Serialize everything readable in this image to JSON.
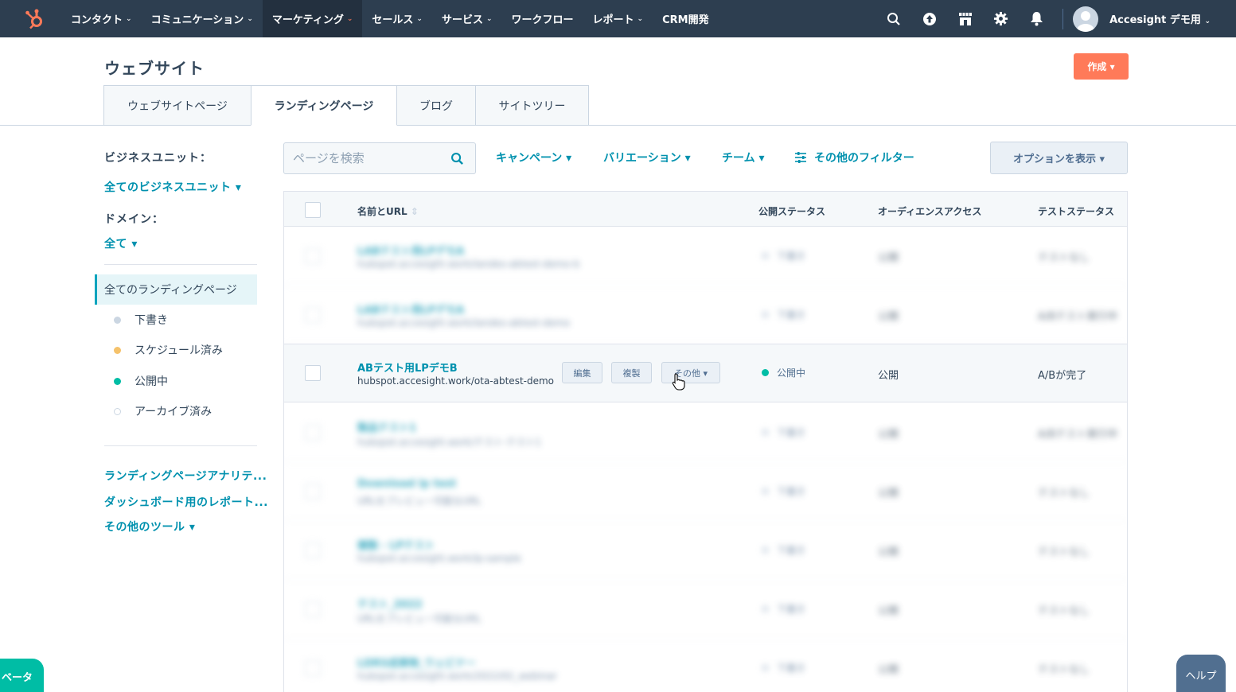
{
  "topnav": {
    "items": [
      {
        "label": "コンタクト",
        "has_menu": true
      },
      {
        "label": "コミュニケーション",
        "has_menu": true
      },
      {
        "label": "マーケティング",
        "has_menu": true,
        "active": true
      },
      {
        "label": "セールス",
        "has_menu": true
      },
      {
        "label": "サービス",
        "has_menu": true
      },
      {
        "label": "ワークフロー",
        "has_menu": false
      },
      {
        "label": "レポート",
        "has_menu": true
      },
      {
        "label": "CRM開発",
        "has_menu": false
      }
    ],
    "account_name": "Accesight デモ用",
    "brand_color": "#2d3e50",
    "chevron": "⌄",
    "icons": [
      "search-icon",
      "upgrade-icon",
      "marketplace-icon",
      "settings-icon",
      "notifications-icon"
    ]
  },
  "header": {
    "title": "ウェブサイト",
    "create_label": "作成 ▾",
    "accent": "#ff7a59"
  },
  "tabs": [
    "ウェブサイトページ",
    "ランディングページ",
    "ブログ",
    "サイトツリー"
  ],
  "sidebar": {
    "business_unit_label": "ビジネスユニット：",
    "business_unit_value": "全てのビジネスユニット ▾",
    "domain_label": "ドメイン：",
    "domain_value": "全て ▾",
    "all_pages": "全てのランディングページ",
    "statuses": [
      {
        "label": "下書き",
        "color": "#cbd6e2"
      },
      {
        "label": "スケジュール済み",
        "color": "#f5c26b"
      },
      {
        "label": "公開中",
        "color": "#00bda5"
      },
      {
        "label": "アーカイブ済み",
        "color": "#ffffff"
      }
    ],
    "links": [
      "ランディングページアナリテ...",
      "ダッシュボード用のレポート...",
      "その他のツール ▾"
    ]
  },
  "filters": {
    "search_placeholder": "ページを検索",
    "campaign": "キャンペーン ▾",
    "variation": "バリエーション ▾",
    "team": "チーム ▾",
    "more_filters": "その他のフィルター",
    "options": "オプションを表示 ▾"
  },
  "table": {
    "headers": [
      "名前とURL",
      "公開ステータス",
      "オーディエンスアクセス",
      "テストステータス"
    ],
    "sort_icon": "⇕",
    "rows": [
      {
        "name": "LABテスト用LPデモA",
        "url": "hubspot.accesight.work/landes-abtest-demo-b",
        "status": "下書き",
        "audience": "公開",
        "test": "テストなし",
        "blurred": true
      },
      {
        "name": "LABテスト用LPデモA",
        "url": "hubspot.accesight.work/landes-abtest-demo",
        "status": "下書き",
        "audience": "公開",
        "test": "A/Bテスト実行中",
        "blurred": true
      },
      {
        "name": "ABテスト用LPデモB",
        "url": "hubspot.accesight.work/ota-abtest-demo",
        "status": "公開中",
        "audience": "公開",
        "test": "A/Bが完了",
        "blurred": false,
        "status_color": "#00bda5"
      },
      {
        "name": "製品テスト1",
        "url": "hubspot.accesight.work/テスト-テスト1",
        "status": "下書き",
        "audience": "公開",
        "test": "A/Bテスト実行中",
        "blurred": true
      },
      {
        "name": "Download lp test",
        "url": "URLをプレビュー可能なURL",
        "status": "下書き",
        "audience": "公開",
        "test": "テストなし",
        "blurred": true
      },
      {
        "name": "複製 - LPテスト",
        "url": "hubspot.accesight.work/lp-sample",
        "status": "下書き",
        "audience": "公開",
        "test": "テストなし",
        "blurred": true
      },
      {
        "name": "テスト_2022",
        "url": "URLをプレビュー可能なURL",
        "status": "下書き",
        "audience": "公開",
        "test": "テストなし",
        "blurred": true
      },
      {
        "name": "LDRS成果物_ウェビナー",
        "url": "hubspot.accesight.work/2022/02_webinar",
        "status": "下書き",
        "audience": "公開",
        "test": "テストなし",
        "blurred": true
      }
    ],
    "row_actions": {
      "edit": "編集",
      "clone": "複製",
      "more": "その他 ▾"
    }
  },
  "floating": {
    "beta": "ベータ",
    "help": "ヘルプ"
  }
}
